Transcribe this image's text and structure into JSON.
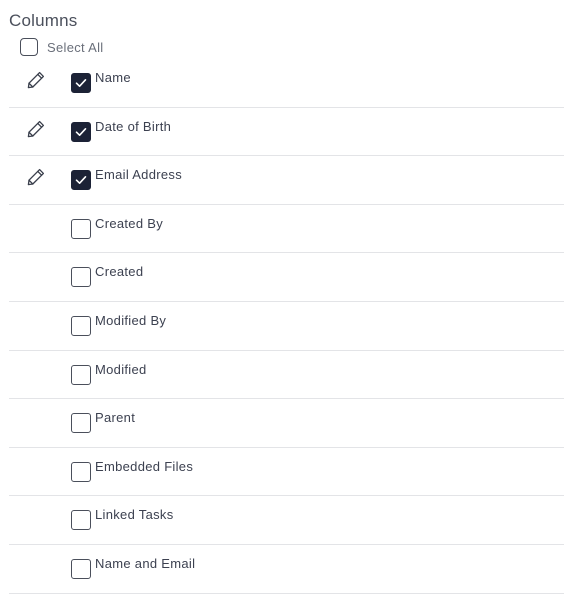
{
  "panel": {
    "title": "Columns",
    "select_all_label": "Select All",
    "select_all_checked": false
  },
  "columns": [
    {
      "label": "Name",
      "checked": true,
      "editable": true
    },
    {
      "label": "Date of Birth",
      "checked": true,
      "editable": true
    },
    {
      "label": "Email Address",
      "checked": true,
      "editable": true
    },
    {
      "label": "Created By",
      "checked": false,
      "editable": false
    },
    {
      "label": "Created",
      "checked": false,
      "editable": false
    },
    {
      "label": "Modified By",
      "checked": false,
      "editable": false
    },
    {
      "label": "Modified",
      "checked": false,
      "editable": false
    },
    {
      "label": "Parent",
      "checked": false,
      "editable": false
    },
    {
      "label": "Embedded Files",
      "checked": false,
      "editable": false
    },
    {
      "label": "Linked Tasks",
      "checked": false,
      "editable": false
    },
    {
      "label": "Name and Email",
      "checked": false,
      "editable": false
    }
  ],
  "icons": {
    "edit": "pencil-icon",
    "check": "checkmark-icon"
  },
  "colors": {
    "checked_fill": "#1c2236",
    "checkbox_border": "#4a4f5b",
    "divider": "#e3e4e7",
    "text": "#3c4150"
  }
}
